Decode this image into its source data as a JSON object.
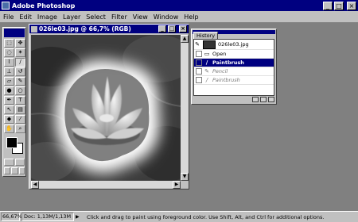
{
  "window": {
    "title": "Adobe Photoshop",
    "minimize": "_",
    "maximize": "□",
    "close": "×"
  },
  "menu": [
    "File",
    "Edit",
    "Image",
    "Layer",
    "Select",
    "Filter",
    "View",
    "Window",
    "Help"
  ],
  "document": {
    "title": "026le03.jpg @ 66,7% (RGB)",
    "minimize": "_",
    "maximize": "□",
    "close": "×"
  },
  "history": {
    "tab": "History",
    "snapshot": "026le03.jpg",
    "states": [
      {
        "label": "Open",
        "icon": "document-icon"
      },
      {
        "label": "Paintbrush",
        "icon": "brush-icon",
        "active": true
      },
      {
        "label": "Pencil",
        "icon": "pencil-icon"
      },
      {
        "label": "Paintbrush",
        "icon": "brush-icon"
      }
    ]
  },
  "status": {
    "zoom": "66,67%",
    "doc": "Doc: 1,13M/1,13M",
    "message": "Click and drag to paint using foreground color.  Use Shift, Alt, and Ctrl for additional options."
  },
  "tools": [
    "marquee-icon",
    "move-icon",
    "lasso-icon",
    "magic-wand-icon",
    "airbrush-icon",
    "paintbrush-icon",
    "rubber-stamp-icon",
    "history-brush-icon",
    "eraser-icon",
    "pencil-icon",
    "blur-icon",
    "dodge-icon",
    "pen-icon",
    "type-icon",
    "measure-icon",
    "gradient-icon",
    "paint-bucket-icon",
    "eyedropper-icon",
    "hand-icon",
    "zoom-icon"
  ],
  "colors": {
    "foreground": "#000000",
    "background": "#ffffff",
    "titlebar": "#000080"
  }
}
